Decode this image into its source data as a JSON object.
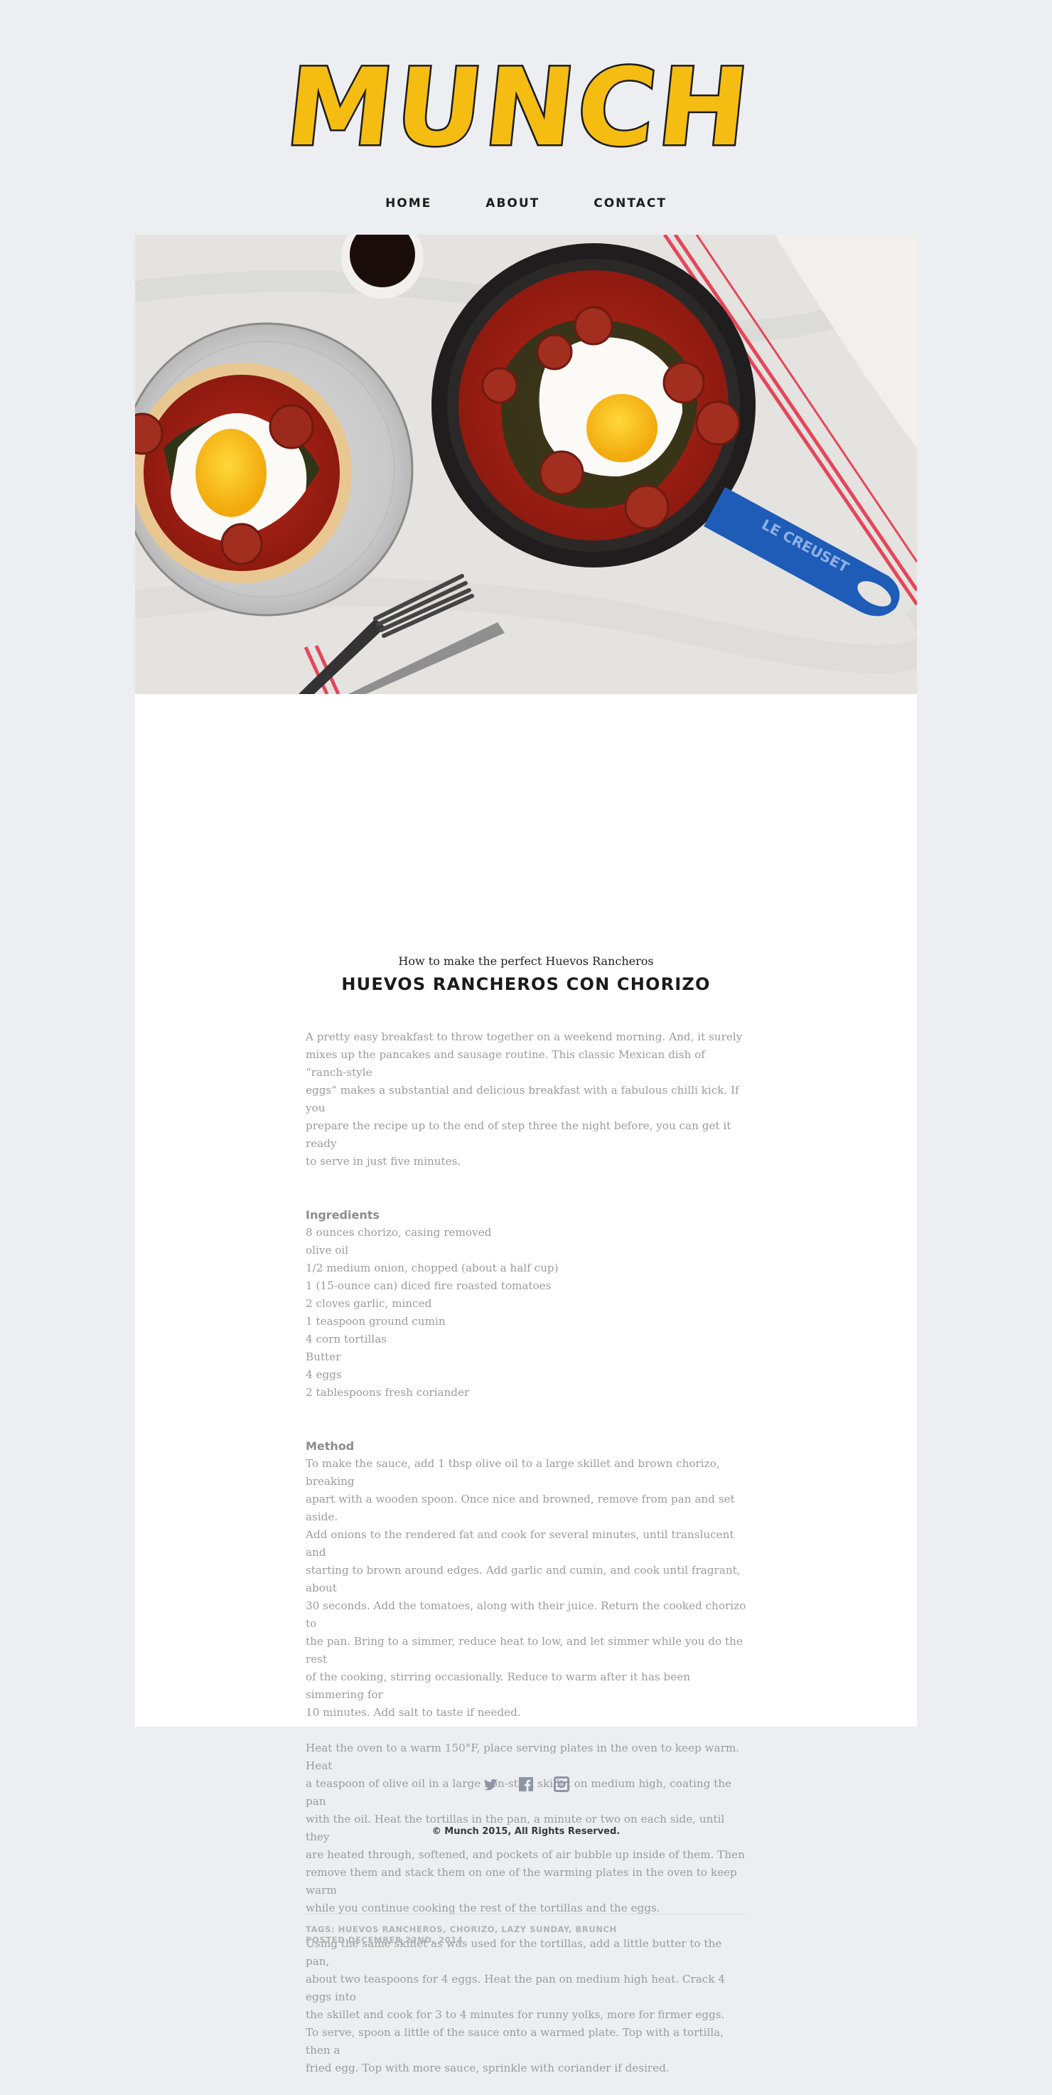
{
  "brand": {
    "logo_text": "MUNCH",
    "logo_color": "#f5bd12",
    "outline_color": "#1c1c1c"
  },
  "nav": {
    "items": [
      "HOME",
      "ABOUT",
      "CONTACT"
    ]
  },
  "post": {
    "subtitle": "How to make the perfect Huevos Rancheros",
    "title": "HUEVOS RANCHEROS CON CHORIZO",
    "intro": [
      "A pretty easy breakfast to throw together on a weekend morning. And, it surely",
      "mixes up the pancakes and sausage routine. This classic Mexican dish of “ranch-style",
      "eggs” makes a substantial and delicious breakfast with a fabulous chilli kick. If you",
      "prepare the recipe up to the end of step three the night before, you can get it ready",
      "to serve in just five minutes."
    ],
    "ingredients_heading": "Ingredients",
    "ingredients": [
      "8 ounces chorizo, casing removed",
      "olive oil",
      "1/2 medium onion, chopped (about a half cup)",
      "1 (15-ounce can) diced fire roasted tomatoes",
      "2 cloves garlic, minced",
      "1 teaspoon ground cumin",
      "4 corn tortillas",
      "Butter",
      "4 eggs",
      "2 tablespoons fresh coriander"
    ],
    "method_heading": "Method",
    "method": [
      [
        "To make the sauce, add 1 tbsp olive oil to a large skillet and brown chorizo, breaking",
        "apart with a wooden spoon. Once nice and browned, remove from pan and set aside.",
        "Add onions to the rendered fat and cook for several minutes, until translucent and",
        "starting to brown around edges. Add garlic and cumin, and cook until fragrant, about",
        "30 seconds. Add the tomatoes, along with their juice. Return the cooked chorizo to",
        "the pan. Bring to a simmer, reduce heat to low, and let simmer while you do the rest",
        "of the cooking, stirring occasionally. Reduce to warm after it has been simmering for",
        "10 minutes. Add salt to taste if needed."
      ],
      [
        "Heat the oven to a warm 150°F, place serving plates in the oven to keep warm. Heat",
        "a teaspoon of olive oil in a large non-stick skillet on medium high, coating the pan",
        "with the oil. Heat the tortillas in the pan, a minute or two on each side, until they",
        "are heated through, softened, and pockets of air bubble up inside of them. Then",
        "remove them and stack them on one of the warming plates in the oven to keep warm",
        "while you continue cooking the rest of the tortillas and the eggs."
      ],
      [
        "Using the same skillet as was used for the tortillas, add a little butter to the pan,",
        "about two teaspoons for 4 eggs. Heat the pan on medium high heat. Crack 4 eggs into",
        "the skillet and cook for 3 to 4 minutes for runny yolks, more for firmer eggs.",
        "To serve, spoon a little of the sauce onto a warmed plate. Top with a tortilla, then a",
        "fried egg. Top with more sauce, sprinkle with coriander if desired."
      ]
    ],
    "tags_label": "TAGS:",
    "tags": [
      "HUEVOS RANCHEROS",
      "CHORIZO",
      "LAZY SUNDAY",
      "BRUNCH"
    ],
    "posted": "POSTED DECEMBER 22ND, 2014",
    "hero_image": {
      "pan_handle_text": "LE CREUSET"
    }
  },
  "footer": {
    "social": [
      "twitter-icon",
      "facebook-icon",
      "instagram-icon"
    ],
    "copyright": "© Munch 2015, All Rights Reserved."
  }
}
